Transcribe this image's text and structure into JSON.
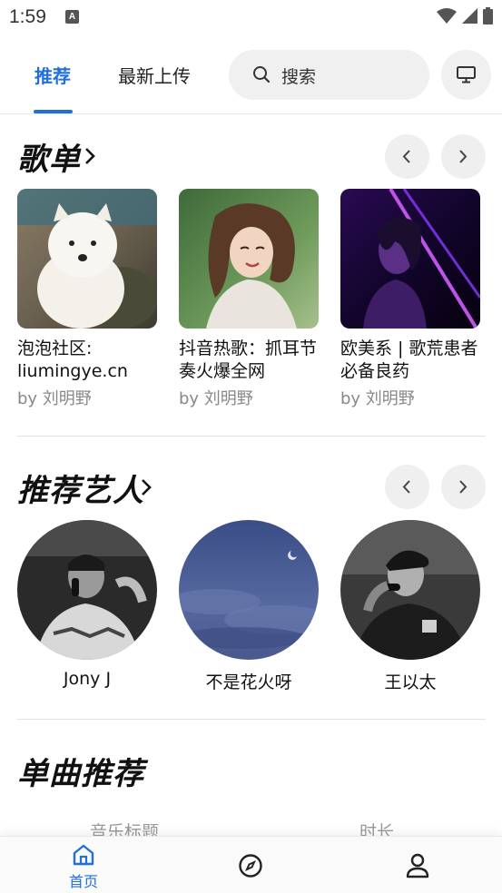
{
  "status_bar": {
    "time": "1:59",
    "notification_badge": "A"
  },
  "top_nav": {
    "tabs": [
      {
        "label": "推荐",
        "active": true
      },
      {
        "label": "最新上传",
        "active": false
      }
    ],
    "search": {
      "placeholder": "搜索",
      "icon": "search-icon"
    },
    "cast_icon": "monitor-icon",
    "accent_color": "#1f6fdf"
  },
  "playlists": {
    "title": "歌单",
    "items": [
      {
        "title": "泡泡社区: liumingye.cn",
        "author": "by 刘明野",
        "cover": "white-puppy"
      },
      {
        "title": "抖音热歌：抓耳节奏火爆全网",
        "author": "by 刘明野",
        "cover": "girl-outdoors"
      },
      {
        "title": "欧美系 | 歌荒患者必备良药",
        "author": "by 刘明野",
        "cover": "neon-portrait"
      }
    ]
  },
  "artists": {
    "title": "推荐艺人",
    "items": [
      {
        "name": "Jony J"
      },
      {
        "name": "不是花火呀"
      },
      {
        "name": "王以太"
      }
    ]
  },
  "songs": {
    "title": "单曲推荐",
    "columns": [
      "音乐标题",
      "时长"
    ]
  },
  "bottom_nav": {
    "items": [
      {
        "label": "首页",
        "icon": "home-icon",
        "active": true
      },
      {
        "label": "",
        "icon": "compass-icon",
        "active": false
      },
      {
        "label": "",
        "icon": "profile-icon",
        "active": false
      }
    ]
  }
}
